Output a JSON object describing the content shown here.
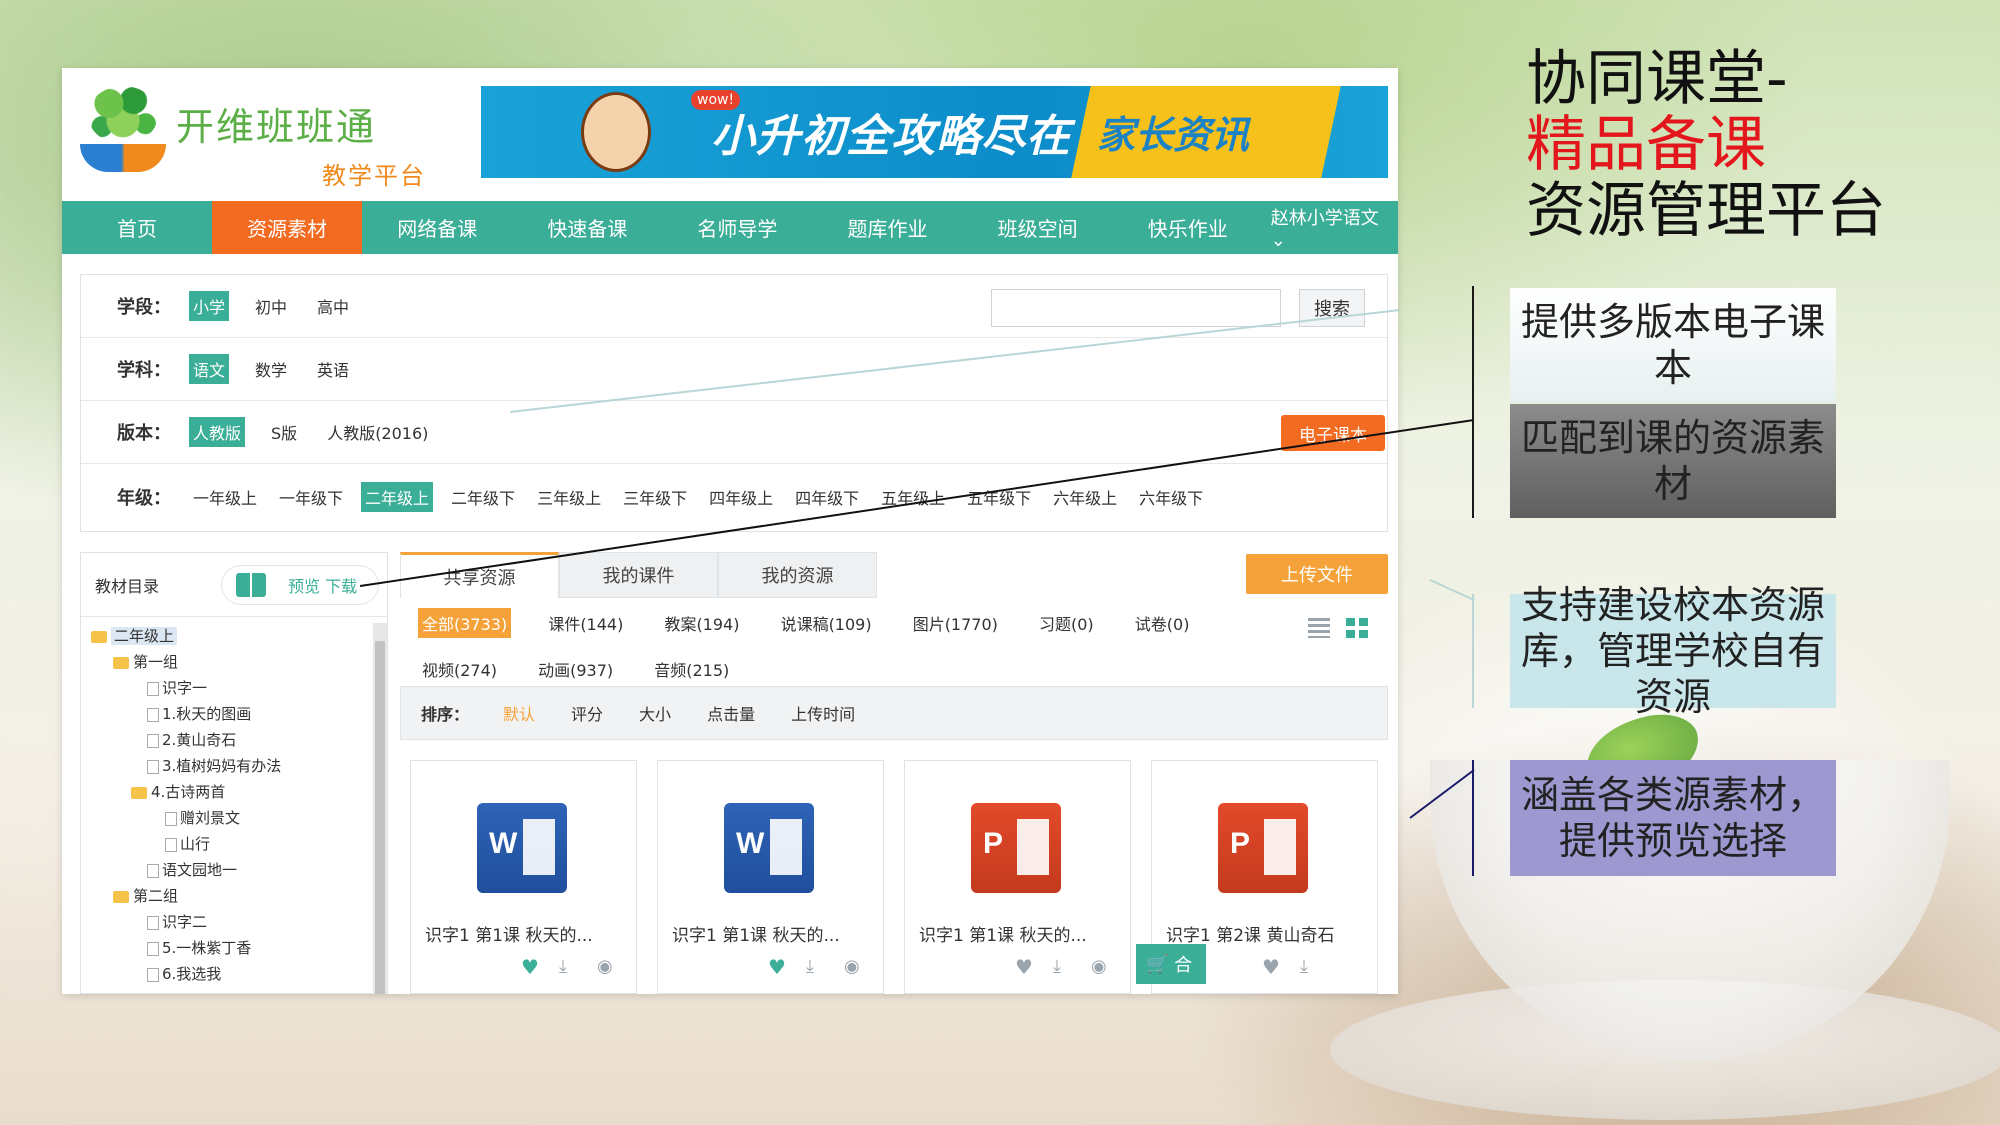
{
  "app": {
    "logo_title": "开维班班通",
    "logo_subtitle": "教学平台",
    "banner": {
      "badge": "wow!",
      "headline": "小升初全攻略尽在",
      "tag": "家长资讯"
    },
    "nav": {
      "items": [
        "首页",
        "资源素材",
        "网络备课",
        "快速备课",
        "名师导学",
        "题库作业",
        "班级空间",
        "快乐作业"
      ],
      "active_index": 1,
      "user": "赵林小学语文"
    },
    "filters": {
      "stage_label": "学段：",
      "stages": [
        "小学",
        "初中",
        "高中"
      ],
      "subject_label": "学科：",
      "subjects": [
        "语文",
        "数学",
        "英语"
      ],
      "edition_label": "版本：",
      "editions": [
        "人教版",
        "S版",
        "人教版(2016)"
      ],
      "grade_label": "年级：",
      "grades": [
        "一年级上",
        "一年级下",
        "二年级上",
        "二年级下",
        "三年级上",
        "三年级下",
        "四年级上",
        "四年级下",
        "五年级上",
        "五年级下",
        "六年级上",
        "六年级下"
      ],
      "search_button": "搜索",
      "search_value": "",
      "ebook_button": "电子课本"
    },
    "sidebar": {
      "title": "教材目录",
      "preview": "预览",
      "download": "下载",
      "tree": {
        "root": "二年级上",
        "group1": "第一组",
        "g1_items": [
          "识字一",
          "1.秋天的图画",
          "2.黄山奇石",
          "3.植树妈妈有办法"
        ],
        "poems": "4.古诗两首",
        "poem_items": [
          "赠刘景文",
          "山行"
        ],
        "garden": "语文园地一",
        "group2": "第二组",
        "g2_items": [
          "识字二",
          "5.一株紫丁香",
          "6.我选我"
        ]
      }
    },
    "main": {
      "tabs": [
        "共享资源",
        "我的课件",
        "我的资源"
      ],
      "upload_button": "上传文件",
      "categories": [
        "全部(3733)",
        "课件(144)",
        "教案(194)",
        "说课稿(109)",
        "图片(1770)",
        "习题(0)",
        "试卷(0)",
        "视频(274)",
        "动画(937)",
        "音频(215)"
      ],
      "sort_label": "排序：",
      "sort_options": [
        "默认",
        "评分",
        "大小",
        "点击量",
        "上传时间"
      ],
      "cards": [
        {
          "type": "word",
          "letter": "W",
          "title": "识字1 第1课 秋天的..."
        },
        {
          "type": "word",
          "letter": "W",
          "title": "识字1 第1课 秋天的..."
        },
        {
          "type": "ppt",
          "letter": "P",
          "title": "识字1 第1课 秋天的..."
        },
        {
          "type": "ppt",
          "letter": "P",
          "title": "识字1 第2课 黄山奇石"
        }
      ],
      "cart_label": "合"
    }
  },
  "slide": {
    "title_line1": "协同课堂-",
    "title_line2": "精品备课",
    "title_line3": "资源管理平台",
    "callouts": [
      "提供多版本电子课本",
      "匹配到课的资源素材",
      "支持建设校本资源库，管理学校自有资源",
      "涵盖各类源素材，提供预览选择"
    ],
    "colors": {
      "accent_red": "#e3161c",
      "nav_teal": "#3aae97",
      "nav_active": "#f26b21"
    }
  }
}
